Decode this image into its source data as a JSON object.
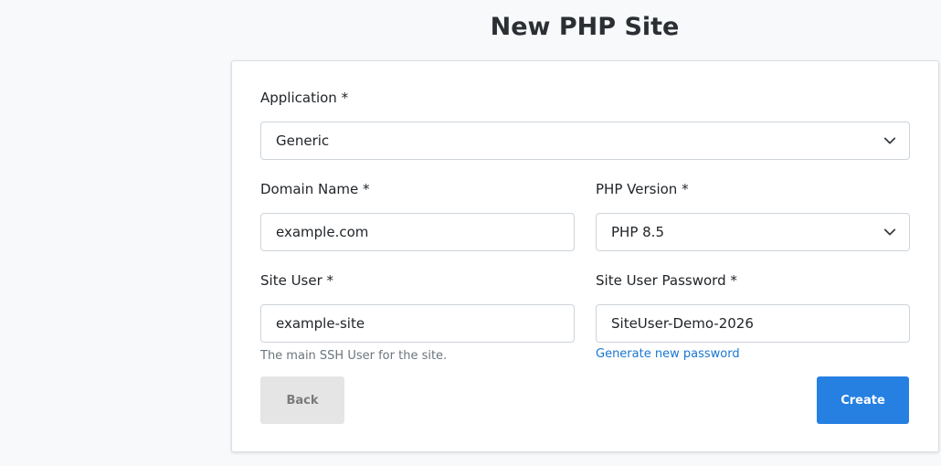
{
  "page": {
    "title": "New PHP Site"
  },
  "form": {
    "application": {
      "label": "Application *",
      "value": "Generic"
    },
    "domain_name": {
      "label": "Domain Name *",
      "value": "example.com"
    },
    "php_version": {
      "label": "PHP Version *",
      "value": "PHP 8.5"
    },
    "site_user": {
      "label": "Site User *",
      "value": "example-site",
      "help": "The main SSH User for the site."
    },
    "site_user_password": {
      "label": "Site User Password *",
      "value": "SiteUser-Demo-2026",
      "generate_link": "Generate new password"
    }
  },
  "actions": {
    "back_label": "Back",
    "create_label": "Create"
  },
  "icons": {
    "select_arrow": "chevron-down-icon"
  },
  "colors": {
    "primary": "#2680e2",
    "link": "#1a76d2",
    "secondary_button": "#e5e5e5"
  }
}
